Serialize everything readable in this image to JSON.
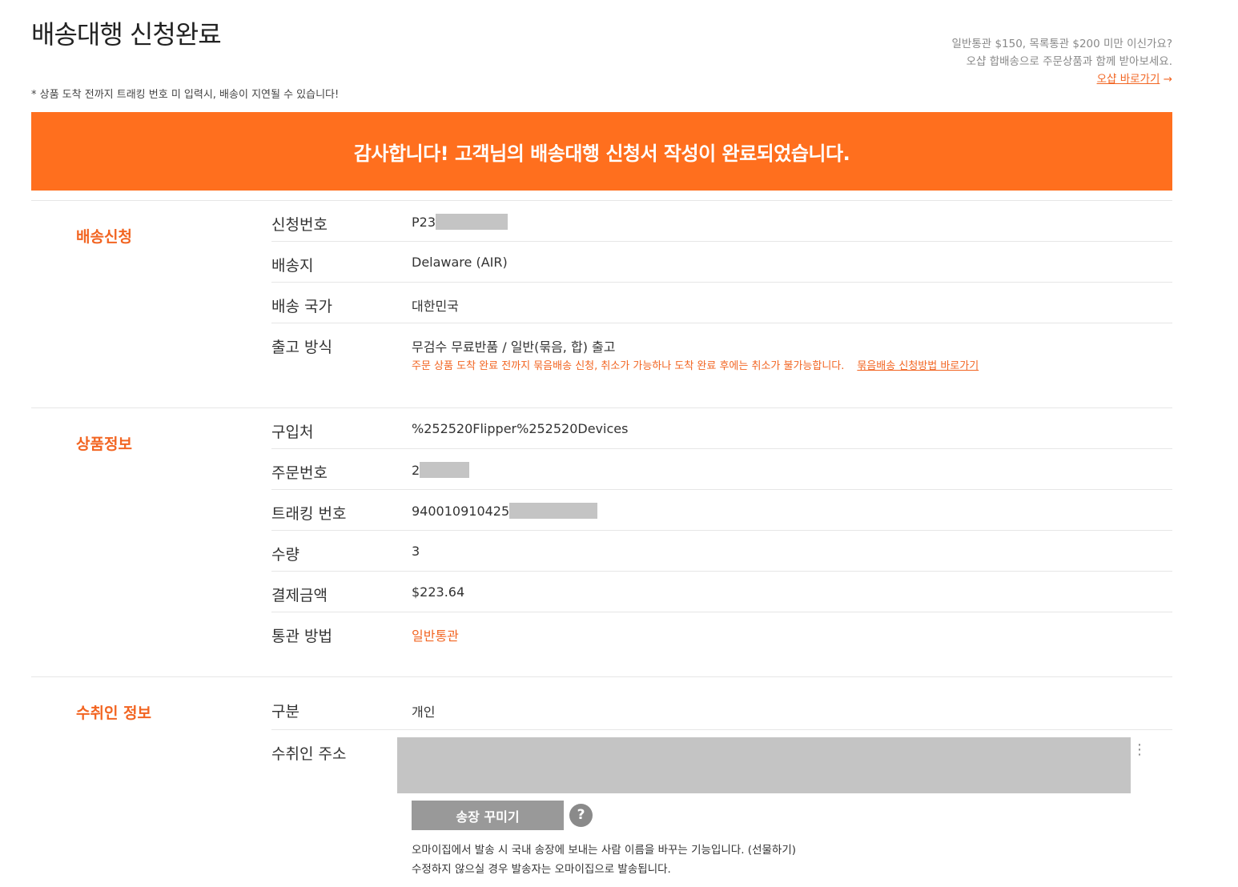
{
  "header": {
    "title": "배송대행 신청완료",
    "tracking_note": "* 상품 도착 전까지 트래킹 번호 미 입력시, 배송이 지연될 수 있습니다!",
    "promo_line1": "일반통관 $150, 목록통관 $200 미만 이신가요?",
    "promo_line2": "오샵 합배송으로 주문상품과 함께 받아보세요.",
    "promo_link": "오샵 바로가기",
    "promo_arrow": "→"
  },
  "banner": {
    "text": "감사합니다! 고객님의 배송대행 신청서 작성이 완료되었습니다."
  },
  "sections": {
    "shipping": {
      "title": "배송신청",
      "rows": [
        {
          "label": "신청번호",
          "value": "P23"
        },
        {
          "label": "배송지",
          "value": "Delaware (AIR)"
        },
        {
          "label": "배송 국가",
          "value": "대한민국"
        },
        {
          "label": "출고 방식",
          "value": "무검수 무료반품 / 일반(묶음, 합) 출고",
          "note": "주문 상품 도착 완료 전까지 묶음배송 신청, 취소가 가능하나 도착 완료 후에는 취소가 불가능합니다.",
          "note_link": "묶음배송 신청방법 바로가기"
        }
      ]
    },
    "product": {
      "title": "상품정보",
      "rows": [
        {
          "label": "구입처",
          "value": "%252520Flipper%252520Devices"
        },
        {
          "label": "주문번호",
          "value": "2"
        },
        {
          "label": "트래킹 번호",
          "value": "940010910425"
        },
        {
          "label": "수량",
          "value": "3"
        },
        {
          "label": "결제금액",
          "value": "$223.64"
        },
        {
          "label": "통관 방법",
          "value": "일반통관"
        }
      ]
    },
    "recipient": {
      "title": "수취인 정보",
      "rows": [
        {
          "label": "구분",
          "value": "개인"
        },
        {
          "label": "수취인 주소"
        }
      ],
      "decorate_button": "송장 꾸미기",
      "help_icon": "?",
      "more_icon": "⋮",
      "desc_line1": "오마이집에서 발송 시 국내 송장에 보내는 사람 이름을 바꾸는 기능입니다. (선물하기)",
      "desc_line2": "수정하지 않으실 경우 발송자는 오마이집으로 발송됩니다."
    }
  },
  "colors": {
    "accent": "#f26522",
    "banner_bg": "#ff6f1e",
    "button_bg": "#999999",
    "redaction": "#c4c4c4"
  }
}
